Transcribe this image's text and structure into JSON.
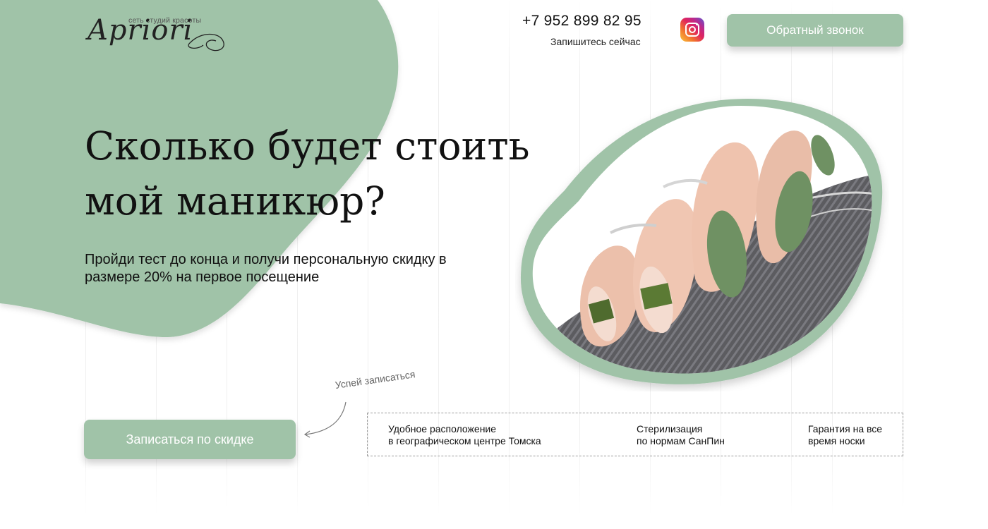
{
  "brand": {
    "tagline": "сеть студий красоты",
    "name": "Apriori"
  },
  "header": {
    "phone": "+7 952 899 82 95",
    "signup_note": "Запишитесь сейчас",
    "instagram_icon": "instagram-icon",
    "callback_label": "Обратный звонок"
  },
  "hero": {
    "headline": "Сколько будет стоить мой маникюр?",
    "subtitle": "Пройди тест до конца и получи персональную скидку в размере 20% на первое посещение",
    "image_alt": "manicure-photo"
  },
  "cta": {
    "hint": "Успей записаться",
    "button_label": "Записаться по скидке"
  },
  "features": [
    {
      "line1": "Удобное расположение",
      "line2": "в географическом центре Томска"
    },
    {
      "line1": "Стерилизация",
      "line2": "по нормам СанПин"
    },
    {
      "line1": "Гарантия на все",
      "line2": "время носки"
    }
  ],
  "colors": {
    "accent": "#a0c3a8",
    "accent_dark": "#8fb598",
    "text": "#111111",
    "nail_green": "#6f9163",
    "skin": "#efc4b0"
  }
}
